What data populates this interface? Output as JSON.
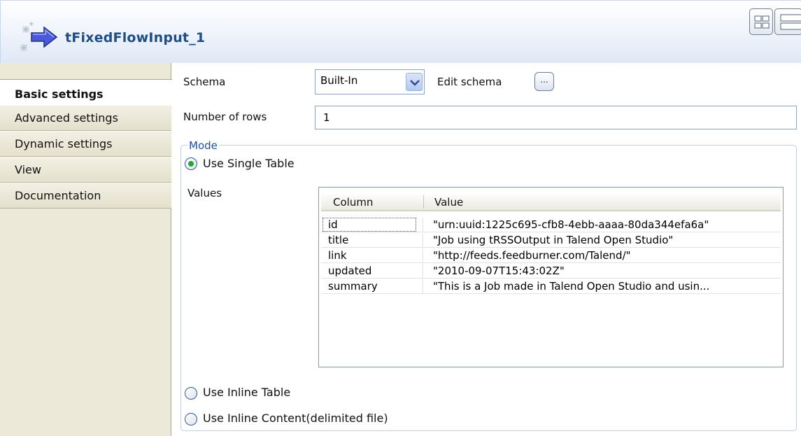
{
  "header": {
    "title": "tFixedFlowInput_1"
  },
  "sidebar": {
    "tabs": [
      {
        "label": "Basic settings",
        "active": true
      },
      {
        "label": "Advanced settings"
      },
      {
        "label": "Dynamic settings"
      },
      {
        "label": "View"
      },
      {
        "label": "Documentation"
      }
    ]
  },
  "form": {
    "schema_label": "Schema",
    "schema_value": "Built-In",
    "edit_schema_label": "Edit schema",
    "edit_schema_button": "...",
    "rows_label": "Number of rows",
    "rows_value": "1"
  },
  "mode": {
    "legend": "Mode",
    "options": [
      {
        "label": "Use Single Table",
        "checked": true
      },
      {
        "label": "Use Inline Table",
        "checked": false
      },
      {
        "label": "Use Inline Content(delimited file)",
        "checked": false
      }
    ],
    "values_label": "Values"
  },
  "table": {
    "columns": [
      "Column",
      "Value"
    ],
    "rows": [
      {
        "column": "id",
        "value": "\"urn:uuid:1225c695-cfb8-4ebb-aaaa-80da344efa6a\""
      },
      {
        "column": "title",
        "value": "\"Job using tRSSOutput in Talend Open Studio\""
      },
      {
        "column": "link",
        "value": "\"http://feeds.feedburner.com/Talend/\""
      },
      {
        "column": "updated",
        "value": "\"2010-09-07T15:43:02Z\""
      },
      {
        "column": "summary",
        "value": "\"This is a Job made in Talend Open Studio and usin..."
      }
    ]
  },
  "colors": {
    "title": "#1f4d86",
    "legend": "#1f4f9f",
    "radio_selected": "#2aa33b"
  }
}
